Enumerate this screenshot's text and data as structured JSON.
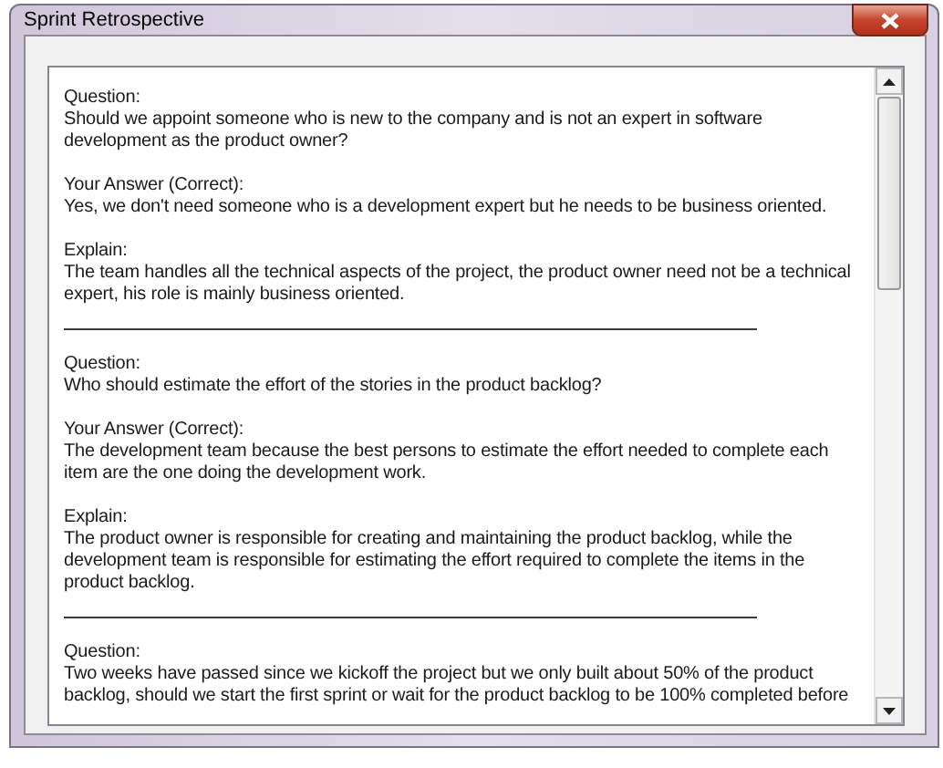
{
  "window": {
    "title": "Sprint Retrospective"
  },
  "entries": [
    {
      "sections": [
        {
          "label": "Question:",
          "lines": [
            "Should we appoint someone who is new to the company and is not an expert in software",
            "development as the product owner?"
          ]
        },
        {
          "label": "Your Answer (Correct):",
          "lines": [
            "Yes, we don't need someone who is a development expert but he needs to be business oriented."
          ]
        },
        {
          "label": "Explain:",
          "lines": [
            "The team handles all the technical aspects of the project, the product owner need not be a technical",
            "expert, his role is mainly business oriented."
          ]
        }
      ]
    },
    {
      "sections": [
        {
          "label": "Question:",
          "lines": [
            "Who should estimate the effort of the stories in the product backlog?"
          ]
        },
        {
          "label": "Your Answer (Correct):",
          "lines": [
            "The development team because the best persons to estimate the effort needed to complete each",
            "item  are the one doing the development work."
          ]
        },
        {
          "label": "Explain:",
          "lines": [
            "The product owner is responsible for creating and maintaining the product backlog, while the",
            "development team is responsible for estimating the effort required to complete the items in the",
            "product backlog."
          ]
        }
      ]
    },
    {
      "sections": [
        {
          "label": "Question:",
          "lines": [
            "Two weeks have passed since we kickoff the project but we only built about 50% of the product",
            "backlog, should we start the first sprint or wait for the product backlog to be 100% completed before"
          ]
        }
      ]
    }
  ]
}
